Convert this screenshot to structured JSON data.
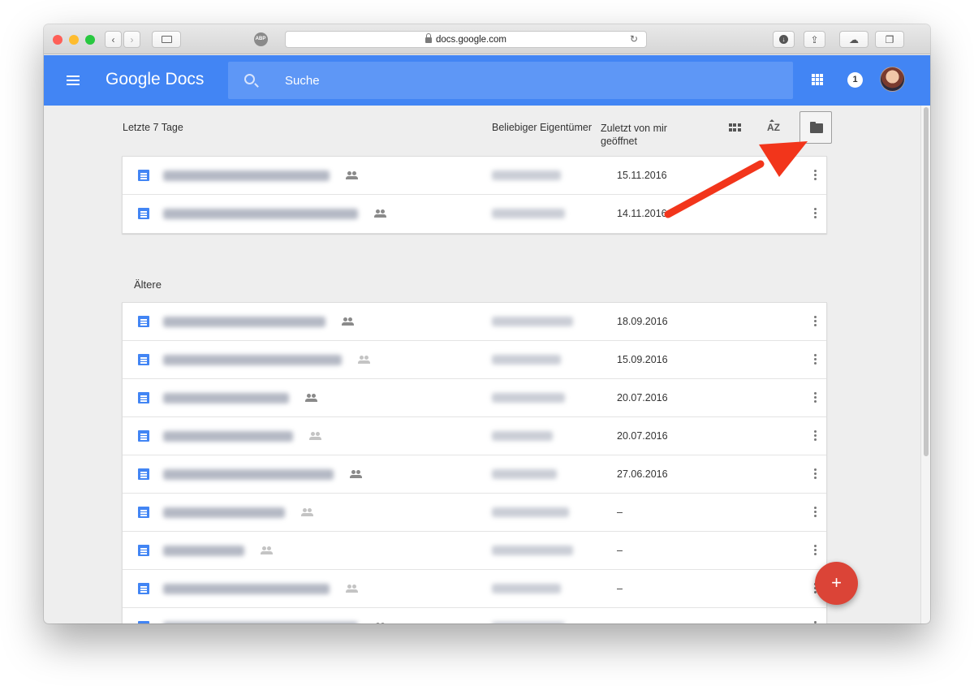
{
  "browser": {
    "url": "docs.google.com",
    "traffic_colors": [
      "#fe5f57",
      "#febc2e",
      "#28c840"
    ],
    "abp_label": "ABP",
    "new_tab_label": "+"
  },
  "appbar": {
    "title": "Google Docs",
    "search_placeholder": "Suche",
    "notification_count": "1",
    "color": "#4285f4"
  },
  "list_header": {
    "section_title": "Letzte 7 Tage",
    "owner_filter": "Beliebiger Eigentümer",
    "sort_label_line1": "Zuletzt von mir",
    "sort_label_line2": "geöffnet",
    "az_label": "AZ"
  },
  "recent": [
    {
      "date": "15.11.2016",
      "shared": true
    },
    {
      "date": "14.11.2016",
      "shared": true
    }
  ],
  "older_title": "Ältere",
  "older": [
    {
      "date": "18.09.2016",
      "shared": true
    },
    {
      "date": "15.09.2016",
      "shared": false
    },
    {
      "date": "20.07.2016",
      "shared": true
    },
    {
      "date": "20.07.2016",
      "shared": false
    },
    {
      "date": "27.06.2016",
      "shared": true
    },
    {
      "date": "–",
      "shared": false
    },
    {
      "date": "–",
      "shared": false
    },
    {
      "date": "–",
      "shared": false
    },
    {
      "date": "–",
      "shared": true
    }
  ],
  "fab_label": "+",
  "arrow_color": "#f2351b"
}
